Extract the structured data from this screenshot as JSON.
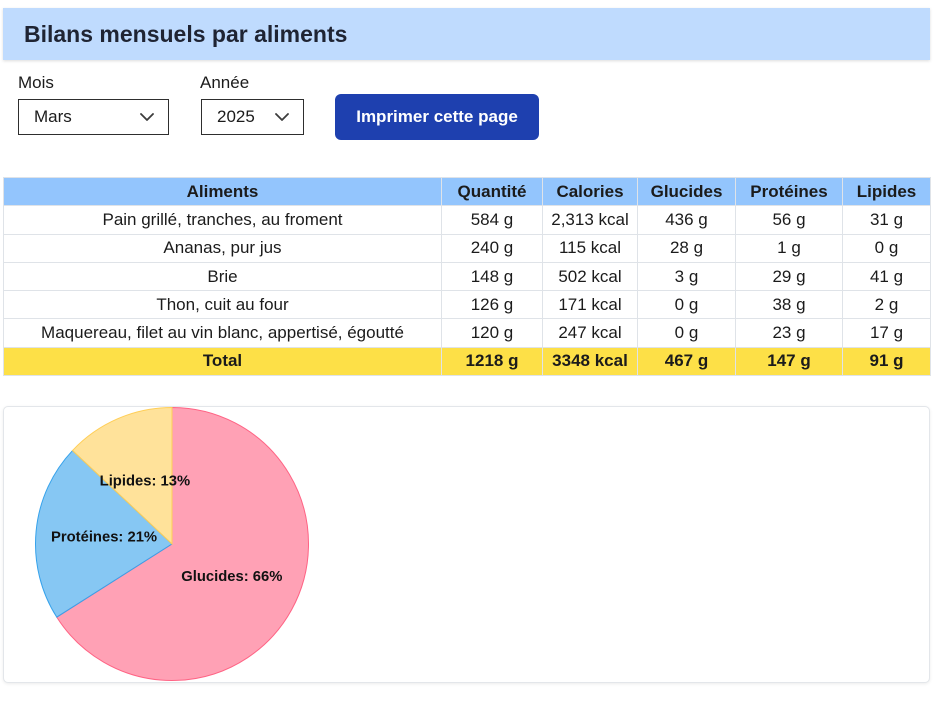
{
  "header": {
    "title": "Bilans mensuels par aliments"
  },
  "filters": {
    "month": {
      "label": "Mois",
      "value": "Mars"
    },
    "year": {
      "label": "Année",
      "value": "2025"
    }
  },
  "actions": {
    "print_label": "Imprimer cette page"
  },
  "theme": {
    "header_background": "#bfdbfe",
    "table_header_background": "#93c5fd",
    "total_row_background": "#fde047",
    "button_background": "#1e40af",
    "button_text": "#ffffff"
  },
  "table": {
    "columns": [
      "Aliments",
      "Quantité",
      "Calories",
      "Glucides",
      "Protéines",
      "Lipides"
    ],
    "rows": [
      [
        "Pain grillé, tranches, au froment",
        "584 g",
        "2,313 kcal",
        "436 g",
        "56 g",
        "31 g"
      ],
      [
        "Ananas, pur jus",
        "240 g",
        "115 kcal",
        "28 g",
        "1 g",
        "0 g"
      ],
      [
        "Brie",
        "148 g",
        "502 kcal",
        "3 g",
        "29 g",
        "41 g"
      ],
      [
        "Thon, cuit au four",
        "126 g",
        "171 kcal",
        "0 g",
        "38 g",
        "2 g"
      ],
      [
        "Maquereau, filet au vin blanc, appertisé, égoutté",
        "120 g",
        "247 kcal",
        "0 g",
        "23 g",
        "17 g"
      ]
    ],
    "total": [
      "Total",
      "1218 g",
      "3348 kcal",
      "467 g",
      "147 g",
      "91 g"
    ]
  },
  "chart_data": {
    "type": "pie",
    "categories": [
      "Glucides",
      "Protéines",
      "Lipides"
    ],
    "values": [
      66,
      21,
      13
    ],
    "unit": "%",
    "colors": [
      "#ff6384",
      "#36a2eb",
      "#ffce56"
    ],
    "legend": "none"
  }
}
